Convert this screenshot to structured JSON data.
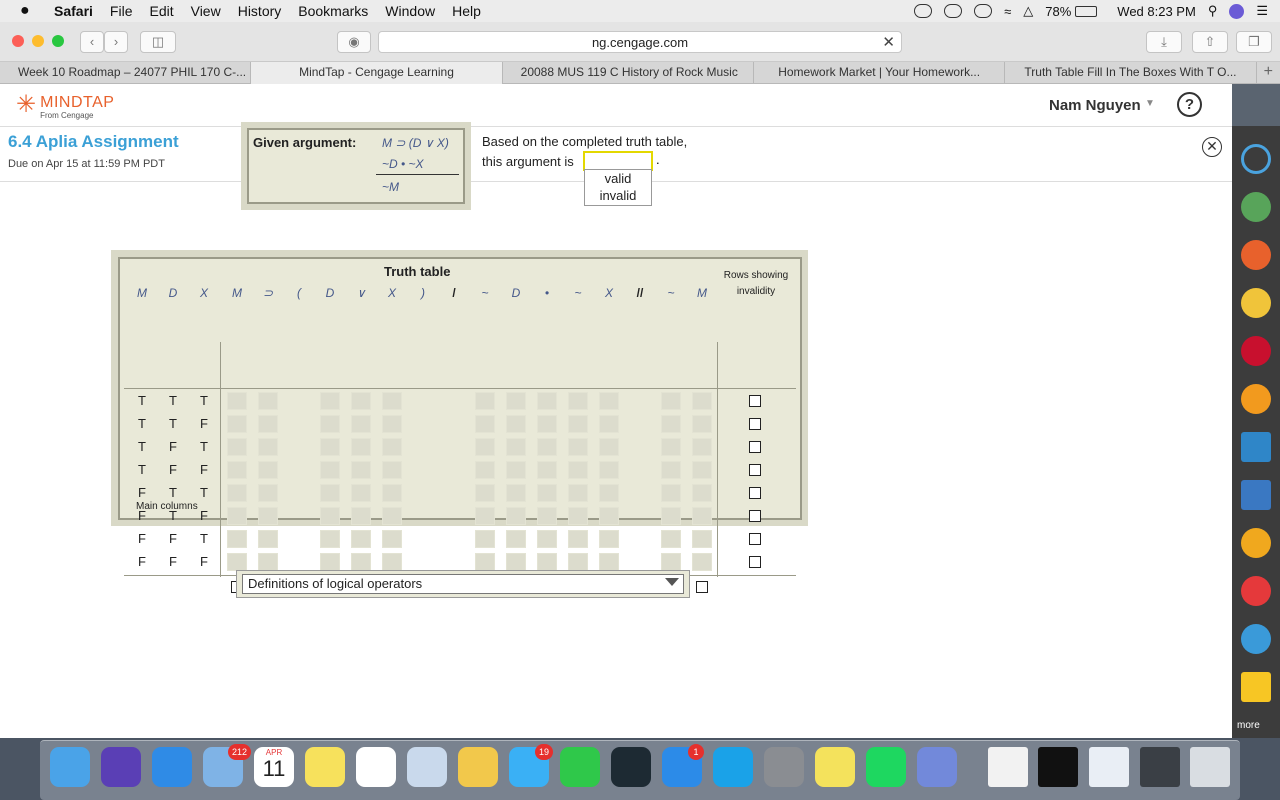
{
  "menubar": {
    "apple": "",
    "app": "Safari",
    "items": [
      "File",
      "Edit",
      "View",
      "History",
      "Bookmarks",
      "Window",
      "Help"
    ],
    "battery": "78%",
    "clock": "Wed 8:23 PM"
  },
  "browser": {
    "url": "ng.cengage.com",
    "tabs": [
      "Week 10 Roadmap – 24077 PHIL 170 C-...",
      "MindTap - Cengage Learning",
      "20088 MUS 119 C History of Rock Music",
      "Homework Market | Your Homework...",
      "Truth Table Fill In The Boxes With T O..."
    ]
  },
  "mindtap": {
    "logo": "MINDTAP",
    "logo_sub": "From Cengage",
    "user": "Nam Nguyen",
    "help": "?"
  },
  "assignment": {
    "title": "6.4 Aplia Assignment",
    "due": "Due on Apr 15 at 11:59 PM PDT"
  },
  "argument": {
    "label": "Given argument:",
    "premise1": "M ⊃ (D ∨ X)",
    "premise2": "~D • ~X",
    "conclusion": "~M"
  },
  "question": {
    "line1": "Based on the completed truth table,",
    "line2": "this argument is",
    "answer": "",
    "period": ".",
    "options": [
      "valid",
      "invalid"
    ]
  },
  "truth_table": {
    "title": "Truth table",
    "rows_showing": "Rows showing invalidity",
    "main_columns_label": "Main columns",
    "var_headers": [
      "M",
      "D",
      "X"
    ],
    "formula_headers": [
      "M",
      "⊃",
      "(",
      "D",
      "∨",
      "X",
      ")",
      "/",
      "~",
      "D",
      "•",
      "~",
      "X",
      "//",
      "~",
      "M"
    ],
    "rows": [
      [
        "T",
        "T",
        "T"
      ],
      [
        "T",
        "T",
        "F"
      ],
      [
        "T",
        "F",
        "T"
      ],
      [
        "T",
        "F",
        "F"
      ],
      [
        "F",
        "T",
        "T"
      ],
      [
        "F",
        "T",
        "F"
      ],
      [
        "F",
        "F",
        "T"
      ],
      [
        "F",
        "F",
        "F"
      ]
    ]
  },
  "definitions": {
    "label": "Definitions of logical operators"
  },
  "rail": {
    "more": "more"
  },
  "dock": {
    "mail_badge": "212",
    "messages_badge": "19",
    "appstore_badge": "1",
    "calendar_month": "APR",
    "calendar_day": "11"
  }
}
